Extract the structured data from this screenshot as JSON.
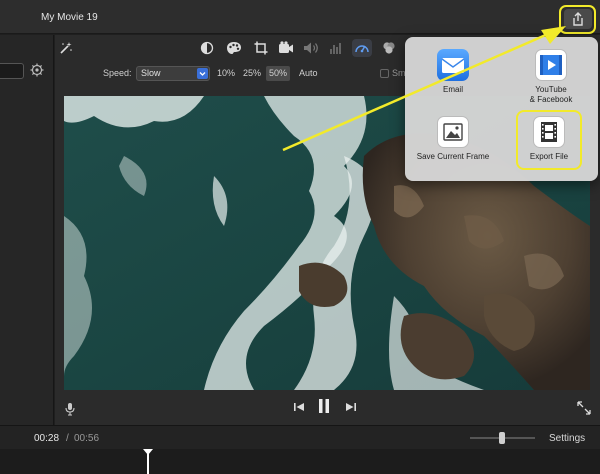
{
  "window": {
    "title": "My Movie 19"
  },
  "toolbar": {
    "icons": [
      "magic-wand-icon",
      "color-balance-icon",
      "color-palette-icon",
      "crop-icon",
      "camera-icon",
      "volume-icon",
      "equalizer-icon",
      "speedometer-icon",
      "filter-icon"
    ]
  },
  "speed": {
    "label": "Speed:",
    "selected": "Slow",
    "options": [
      "10%",
      "25%",
      "50%",
      "Auto"
    ],
    "selected_option": "50%",
    "smooth_label": "Sm"
  },
  "share_menu": {
    "items": [
      {
        "id": "email",
        "label": "Email"
      },
      {
        "id": "youtube",
        "label_line1": "YouTube",
        "label_line2": "& Facebook"
      },
      {
        "id": "save-frame",
        "label": "Save Current Frame"
      },
      {
        "id": "export",
        "label": "Export File"
      }
    ]
  },
  "timeline": {
    "current": "00:28",
    "separator": "/",
    "total": "00:56",
    "settings_label": "Settings"
  },
  "colors": {
    "highlight": "#f2ea2a",
    "accent_blue": "#3a6fd8"
  }
}
